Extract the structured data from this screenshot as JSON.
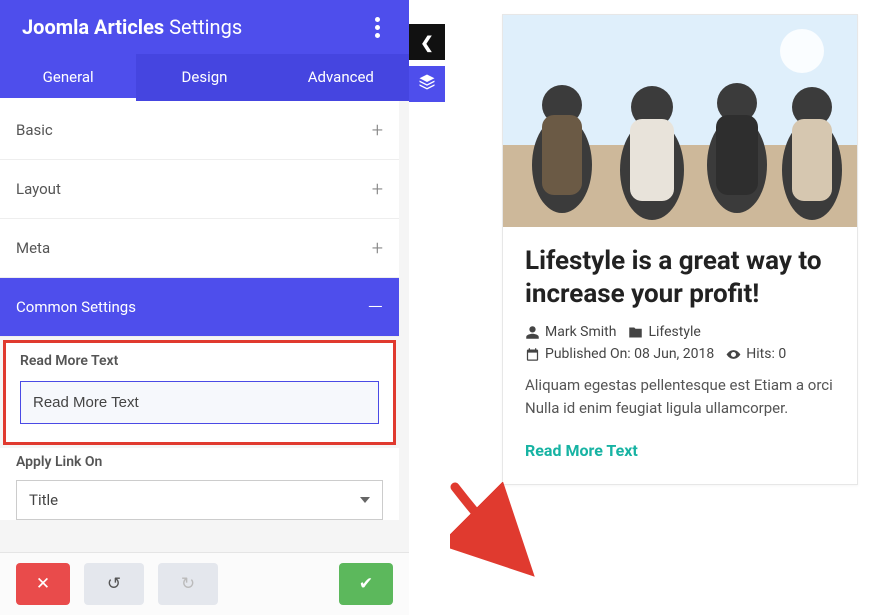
{
  "panel": {
    "title_bold": "Joomla Articles",
    "title_rest": "Settings"
  },
  "tabs": [
    {
      "label": "General",
      "active": true
    },
    {
      "label": "Design",
      "active": false
    },
    {
      "label": "Advanced",
      "active": false
    }
  ],
  "sections": {
    "basic": "Basic",
    "layout": "Layout",
    "meta": "Meta",
    "common": "Common Settings"
  },
  "fields": {
    "read_more_label": "Read More Text",
    "read_more_value": "Read More Text",
    "apply_link_label": "Apply Link On",
    "apply_link_value": "Title"
  },
  "article": {
    "title": "Lifestyle is a great way to increase your profit!",
    "author": "Mark Smith",
    "category": "Lifestyle",
    "published_label": "Published On: 08 Jun, 2018",
    "hits_label": "Hits: 0",
    "excerpt": "Aliquam egestas pellentesque est Etiam a orci Nulla id enim feugiat ligula ullamcorper.",
    "read_more": "Read More Text"
  },
  "colors": {
    "accent": "#4e4eec",
    "highlight": "#e03a2f",
    "readmore": "#17b3a3",
    "success": "#5cb85c",
    "danger": "#e94b4b"
  }
}
